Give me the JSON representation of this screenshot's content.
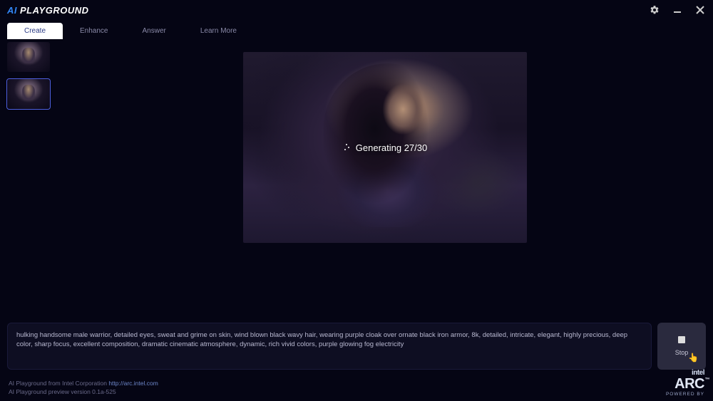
{
  "app": {
    "logo_ai": "AI",
    "logo_play": "PLAYGROUND"
  },
  "tabs": {
    "create": "Create",
    "enhance": "Enhance",
    "answer": "Answer",
    "learn": "Learn More"
  },
  "generation": {
    "label_prefix": "Generating ",
    "current": 27,
    "total": 30,
    "status_text": "Generating 27/30"
  },
  "prompt": {
    "text": "hulking handsome male warrior, detailed eyes, sweat and grime on skin, wind blown black wavy hair, wearing purple cloak over ornate black iron armor, 8k, detailed, intricate, elegant, highly precious, deep color, sharp focus, excellent composition, dramatic cinematic atmosphere, dynamic, rich vivid colors, purple glowing fog electricity"
  },
  "buttons": {
    "stop": "Stop"
  },
  "footer": {
    "line1_prefix": "AI Playground from Intel Corporation ",
    "link_text": "http://arc.intel.com",
    "line2": "AI Playground preview version 0.1a-525"
  },
  "brand": {
    "intel": "intel",
    "arc": "ARC",
    "tm": "™",
    "powered": "POWERED BY"
  },
  "thumbnails": {
    "count": 2,
    "selected_index": 1
  }
}
